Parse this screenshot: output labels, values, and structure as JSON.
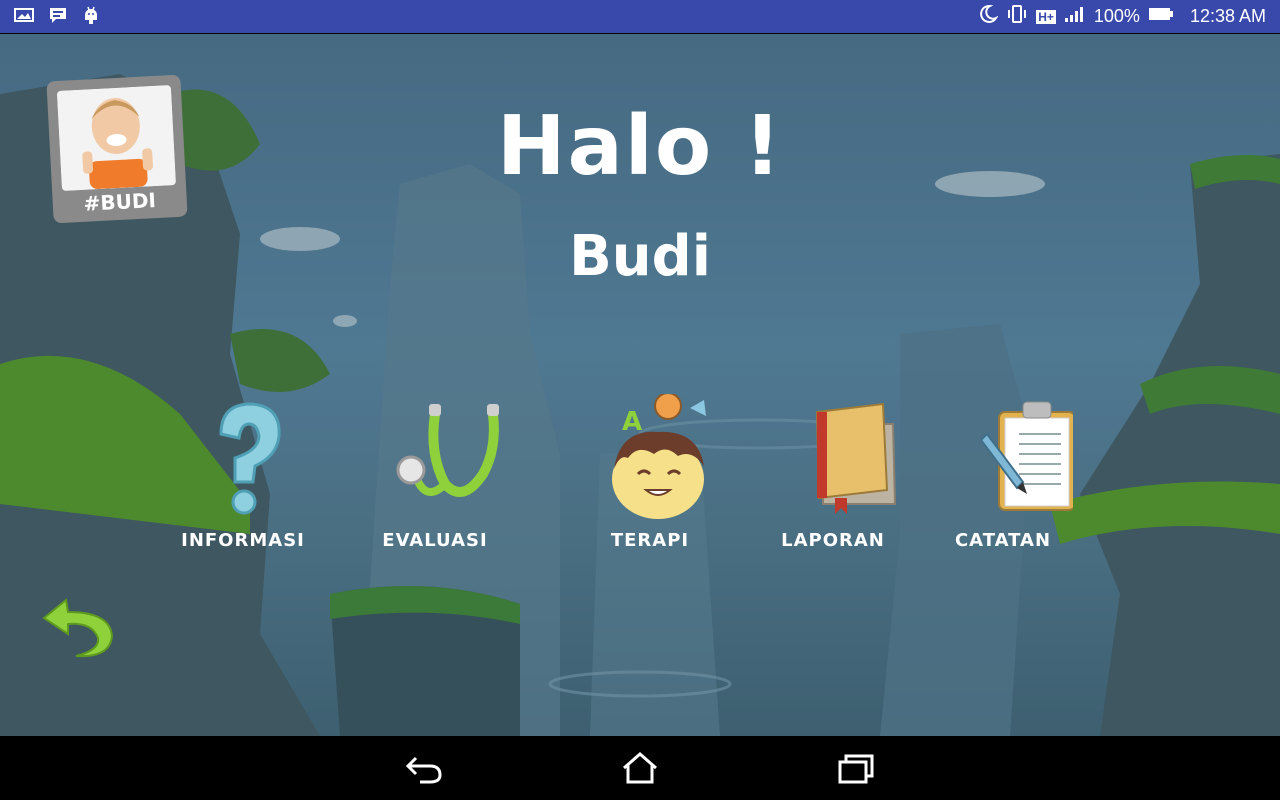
{
  "status_bar": {
    "battery": "100%",
    "time": "12:38 AM",
    "network": "H+"
  },
  "header": {
    "greeting": "Halo !",
    "user_name": "Budi"
  },
  "profile": {
    "tag": "#BUDI"
  },
  "menu": [
    {
      "id": "informasi",
      "label": "INFORMASI",
      "icon": "question-mark-icon"
    },
    {
      "id": "evaluasi",
      "label": "EVALUASI",
      "icon": "stethoscope-icon"
    },
    {
      "id": "terapi",
      "label": "TERAPI",
      "icon": "child-head-icon"
    },
    {
      "id": "laporan",
      "label": "LAPORAN",
      "icon": "book-icon"
    },
    {
      "id": "catatan",
      "label": "CATATAN",
      "icon": "clipboard-icon"
    }
  ],
  "colors": {
    "status_bar": "#3949ab",
    "accent_green": "#8fd13b",
    "text": "#ffffff"
  }
}
